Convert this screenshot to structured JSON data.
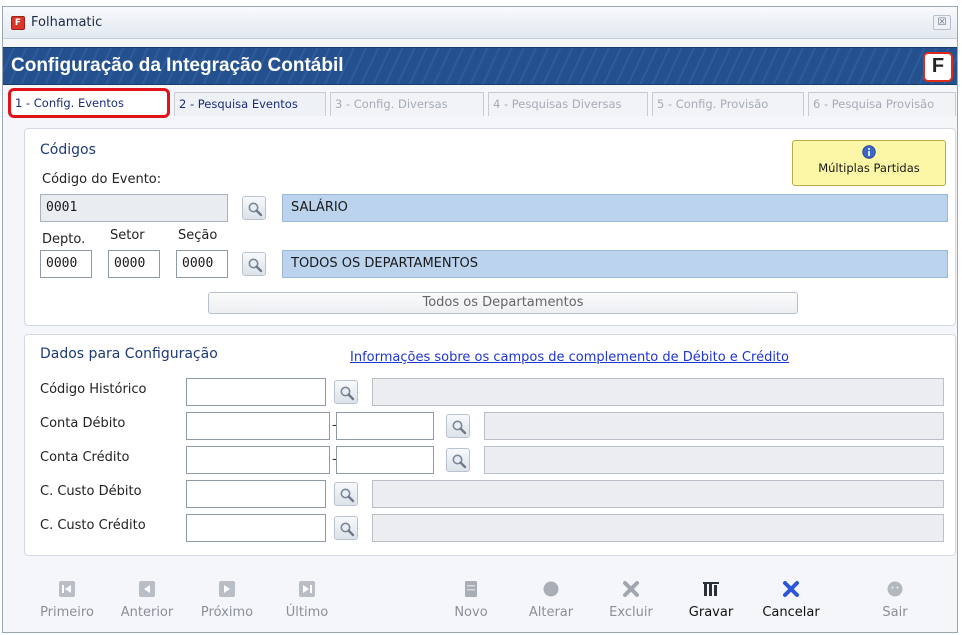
{
  "window": {
    "app_title": "Folhamatic",
    "close_label": "☒",
    "banner_title": "Configuração da Integração Contábil",
    "logo_letter": "F"
  },
  "tabs": [
    {
      "label": "1 - Config. Eventos",
      "state": "active"
    },
    {
      "label": "2 - Pesquisa Eventos",
      "state": "enabled"
    },
    {
      "label": "3 - Config. Diversas",
      "state": "disabled"
    },
    {
      "label": "4 - Pesquisas Diversas",
      "state": "disabled"
    },
    {
      "label": "5 - Config. Provisão",
      "state": "disabled"
    },
    {
      "label": "6 - Pesquisa Provisão",
      "state": "disabled"
    }
  ],
  "codigos": {
    "title": "Códigos",
    "codigo_evento_label": "Código do Evento:",
    "codigo_evento_value": "0001",
    "evento_desc": "SALÁRIO",
    "depto_label": "Depto.",
    "setor_label": "Setor",
    "secao_label": "Seção",
    "depto_value": "0000",
    "setor_value": "0000",
    "secao_value": "0000",
    "departamento_desc": "TODOS OS DEPARTAMENTOS",
    "todos_button": "Todos os Departamentos",
    "multiplas_button": "Múltiplas Partidas"
  },
  "config": {
    "title": "Dados para Configuração",
    "info_link": "Informações sobre os campos de complemento de Débito e Crédito",
    "rows": [
      {
        "label": "Código Histórico"
      },
      {
        "label": "Conta Débito"
      },
      {
        "label": "Conta Crédito"
      },
      {
        "label": "C. Custo Débito"
      },
      {
        "label": "C. Custo Crédito"
      }
    ],
    "dash": "-"
  },
  "toolbar": [
    {
      "label": "Primeiro",
      "icon": "first-icon",
      "enabled": false
    },
    {
      "label": "Anterior",
      "icon": "previous-icon",
      "enabled": false
    },
    {
      "label": "Próximo",
      "icon": "next-icon",
      "enabled": false
    },
    {
      "label": "Último",
      "icon": "last-icon",
      "enabled": false
    },
    {
      "label": "Novo",
      "icon": "new-icon",
      "enabled": false
    },
    {
      "label": "Alterar",
      "icon": "edit-icon",
      "enabled": false
    },
    {
      "label": "Excluir",
      "icon": "delete-icon",
      "enabled": false
    },
    {
      "label": "Gravar",
      "icon": "save-icon",
      "enabled": true
    },
    {
      "label": "Cancelar",
      "icon": "cancel-icon",
      "enabled": true
    },
    {
      "label": "Sair",
      "icon": "exit-icon",
      "enabled": false
    }
  ],
  "colors": {
    "banner": "#24508e",
    "active_tab_border": "#e0131a",
    "link": "#1f34d6",
    "cancel_icon": "#2b56d8",
    "highlight_field": "#bcd3ee",
    "multi_button": "#fbf7a6"
  }
}
